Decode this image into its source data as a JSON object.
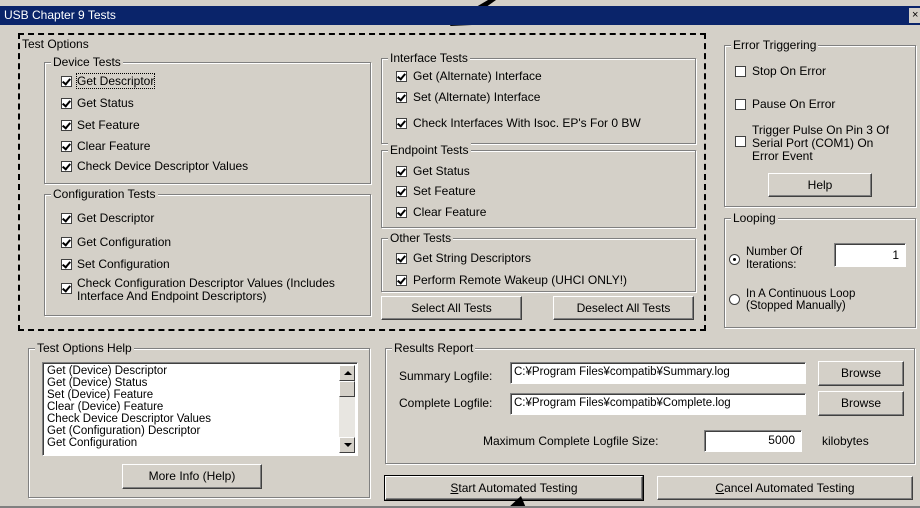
{
  "window": {
    "title": "USB Chapter 9 Tests",
    "close_glyph": "×"
  },
  "test_options": {
    "label": "Test Options",
    "device_tests": {
      "label": "Device Tests",
      "items": [
        "Get Descriptor",
        "Get Status",
        "Set Feature",
        "Clear Feature",
        "Check Device Descriptor Values"
      ]
    },
    "configuration_tests": {
      "label": "Configuration Tests",
      "items": [
        "Get Descriptor",
        "Get Configuration",
        "Set Configuration",
        "Check Configuration Descriptor Values (Includes",
        "Interface And Endpoint Descriptors)"
      ]
    },
    "interface_tests": {
      "label": "Interface Tests",
      "items": [
        "Get (Alternate) Interface",
        "Set (Alternate) Interface",
        "Check Interfaces With Isoc. EP's For 0 BW"
      ]
    },
    "endpoint_tests": {
      "label": "Endpoint Tests",
      "items": [
        "Get Status",
        "Set Feature",
        "Clear Feature"
      ]
    },
    "other_tests": {
      "label": "Other Tests",
      "items": [
        "Get String Descriptors",
        "Perform Remote Wakeup (UHCI ONLY!)"
      ]
    },
    "select_all": "Select All Tests",
    "deselect_all": "Deselect All Tests"
  },
  "error_triggering": {
    "label": "Error Triggering",
    "stop_on_error": "Stop On Error",
    "pause_on_error": "Pause On Error",
    "trigger_line1": "Trigger Pulse On Pin 3 Of",
    "trigger_line2": "Serial Port (COM1) On",
    "trigger_line3": "Error Event",
    "help": "Help"
  },
  "looping": {
    "label": "Looping",
    "iterations_line1": "Number Of",
    "iterations_line2": "Iterations:",
    "iterations_value": "1",
    "continuous_line1": "In A Continuous Loop",
    "continuous_line2": "(Stopped Manually)"
  },
  "help_panel": {
    "label": "Test Options Help",
    "items": [
      "Get (Device) Descriptor",
      "Get (Device) Status",
      "Set (Device) Feature",
      "Clear (Device) Feature",
      "Check Device Descriptor Values",
      "Get (Configuration) Descriptor",
      "Get Configuration"
    ],
    "more_info": "More Info (Help)"
  },
  "results": {
    "label": "Results Report",
    "summary_label": "Summary Logfile:",
    "summary_value": "C:¥Program Files¥compatib¥Summary.log",
    "complete_label": "Complete Logfile:",
    "complete_value": "C:¥Program Files¥compatib¥Complete.log",
    "browse": "Browse",
    "max_size_label": "Maximum Complete Logfile Size:",
    "max_size_value": "5000",
    "max_size_unit": "kilobytes"
  },
  "actions": {
    "start_u": "S",
    "start_rest": "tart Automated Testing",
    "cancel_u": "C",
    "cancel_rest": "ancel Automated Testing"
  }
}
